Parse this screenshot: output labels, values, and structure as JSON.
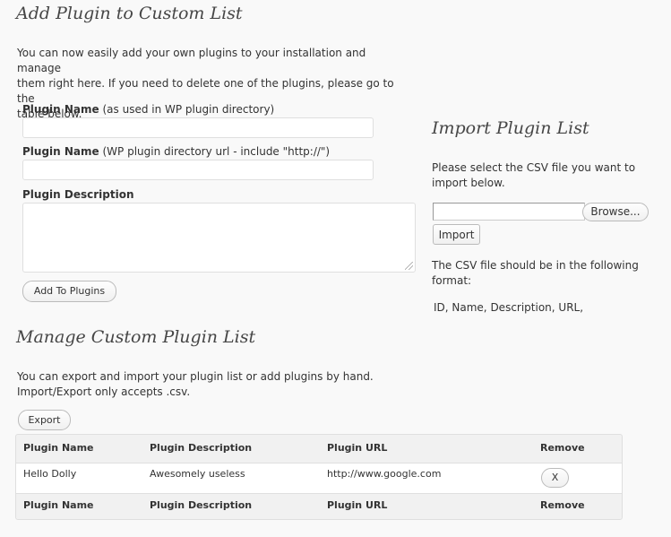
{
  "add_section": {
    "title": "Add Plugin to Custom List",
    "intro_line1": "You can now easily add your own plugins to your installation and manage",
    "intro_line2": "them right here. If you need to delete one of the plugins, please go to the",
    "intro_line3": "table below.",
    "field1_label": "Plugin Name",
    "field1_hint": " (as used in WP plugin directory)",
    "field2_label": "Plugin Name",
    "field2_hint": " (WP plugin directory url - include \"http://\")",
    "field3_label": "Plugin Description",
    "submit_label": "Add To Plugins"
  },
  "import_section": {
    "title": "Import Plugin List",
    "intro_line1": "Please select the CSV file you want to",
    "intro_line2": "import below.",
    "browse_label": "Browse...",
    "import_label": "Import",
    "format_line1": "The CSV file should be in the following",
    "format_line2": "format:",
    "format_value": "ID, Name, Description, URL,"
  },
  "manage_section": {
    "title": "Manage Custom Plugin List",
    "intro_line1": "You can export and import your plugin list or add plugins by hand.",
    "intro_line2": "Import/Export only accepts .csv.",
    "export_label": "Export"
  },
  "table": {
    "columns": [
      "Plugin Name",
      "Plugin Description",
      "Plugin URL",
      "Remove"
    ],
    "rows": [
      {
        "name": "Hello Dolly",
        "description": "Awesomely useless",
        "url": "http://www.google.com",
        "remove_label": "X"
      }
    ]
  }
}
